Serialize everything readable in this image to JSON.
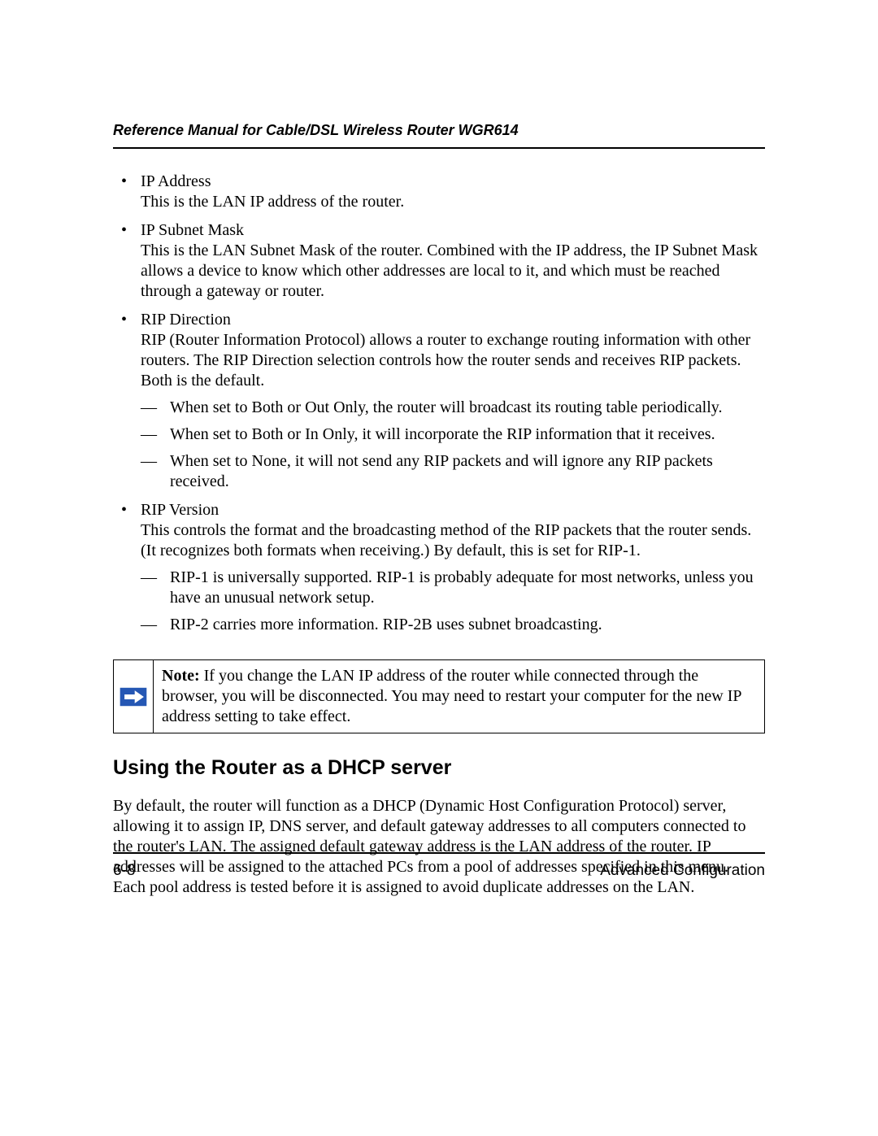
{
  "header": {
    "title": "Reference Manual for Cable/DSL Wireless Router WGR614"
  },
  "bullets": [
    {
      "title": "IP Address",
      "desc": "This is the LAN IP address of the router.",
      "sub": []
    },
    {
      "title": "IP Subnet Mask",
      "desc": "This is the LAN Subnet Mask of the router. Combined with the IP address, the IP Subnet Mask allows a device to know which other addresses are local to it, and which must be reached through a gateway or router.",
      "sub": []
    },
    {
      "title": "RIP Direction",
      "desc": "RIP (Router Information Protocol) allows a router to exchange routing information with other routers. The RIP Direction selection controls how the router sends and receives RIP packets. Both is the default.",
      "sub": [
        "When set to Both or Out Only, the router will broadcast its routing table periodically.",
        "When set to Both or In Only, it will incorporate the RIP information that it receives.",
        "When set to None, it will not send any RIP packets and will ignore any RIP packets received."
      ]
    },
    {
      "title": "RIP Version",
      "desc": "This controls the format and the broadcasting method of the RIP packets that the router sends. (It recognizes both formats when receiving.) By default, this is set for RIP-1.",
      "sub": [
        "RIP-1 is universally supported. RIP-1 is probably adequate for most networks, unless you have an unusual network setup.",
        "RIP-2 carries more information. RIP-2B uses subnet broadcasting."
      ]
    }
  ],
  "note": {
    "label": "Note:",
    "text": " If you change the LAN IP address of the router while connected through the browser, you will be disconnected. You may need to restart your computer for the new IP address setting to take effect."
  },
  "section": {
    "heading": "Using the Router as a DHCP server",
    "body": "By default, the router will function as a DHCP (Dynamic Host Configuration Protocol) server, allowing it to assign IP, DNS server, and default gateway addresses to all computers connected to the router's LAN. The assigned default gateway address is the LAN address of the router. IP addresses will be assigned to the attached PCs from a pool of addresses specified in this menu. Each pool address is tested before it is assigned to avoid duplicate addresses on the LAN."
  },
  "footer": {
    "page": "6-8",
    "chapter": "Advanced Configuration"
  }
}
